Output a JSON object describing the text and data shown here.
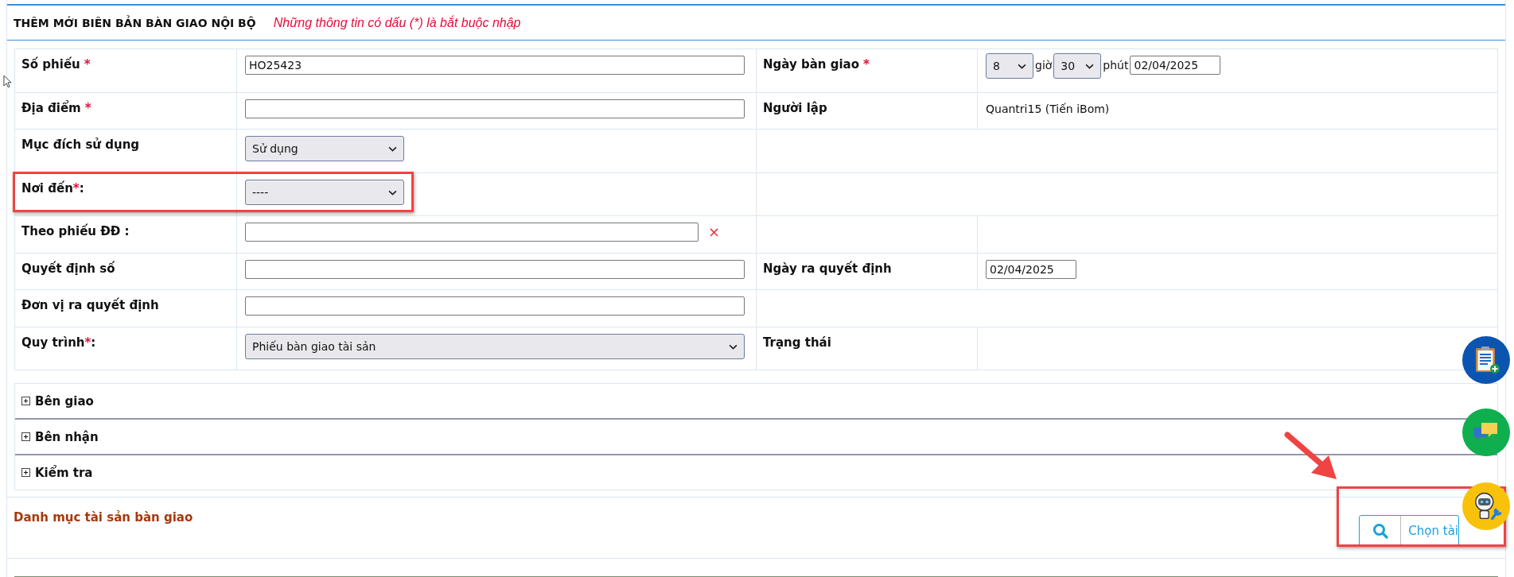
{
  "header": {
    "title": "THÊM MỚI BIÊN BẢN BÀN GIAO NỘI BỘ",
    "note": "Những thông tin có dấu (*) là bắt buộc nhập"
  },
  "rows": [
    {
      "left": {
        "label": "Số phiếu",
        "mark": "*",
        "mark_gap": true,
        "field": {
          "kind": "text",
          "value": "HO25423"
        }
      },
      "right": {
        "kind": "field",
        "label": "Ngày bàn giao",
        "mark": "*",
        "mark_gap": true,
        "field": {
          "kind": "datetime",
          "hour": "8",
          "hour_unit": "giờ",
          "minute": "30",
          "minute_unit": "phút",
          "date": "02/04/2025"
        }
      }
    },
    {
      "left": {
        "label": "Địa điểm",
        "mark": "*",
        "mark_gap": true,
        "field": {
          "kind": "text"
        }
      },
      "right": {
        "kind": "field",
        "label": "Người lập",
        "field": {
          "kind": "static",
          "value": "Quantri15 (Tiến iBom)"
        }
      }
    },
    {
      "left": {
        "label": "Mục đích sử dụng",
        "field": {
          "kind": "select",
          "value": "Sử dụng",
          "wide": false
        }
      },
      "right": {
        "kind": "blank"
      }
    },
    {
      "left": {
        "label": "Nơi đến",
        "mark": "*",
        "mark_gap": false,
        "suffix": ":",
        "field": {
          "kind": "select",
          "value": "----",
          "wide": false
        }
      },
      "right": {
        "kind": "blank"
      }
    },
    {
      "left": {
        "label": "Theo phiếu ĐĐ :",
        "field": {
          "kind": "clearable",
          "clear": "×"
        }
      },
      "right": {
        "kind": "split"
      }
    },
    {
      "left": {
        "label": "Quyết định số",
        "field": {
          "kind": "text"
        }
      },
      "right": {
        "kind": "field",
        "label": "Ngày ra quyết định",
        "field": {
          "kind": "date",
          "value": "02/04/2025"
        }
      }
    },
    {
      "left": {
        "label": "Đơn vị ra quyết định",
        "field": {
          "kind": "text"
        }
      },
      "right": {
        "kind": "blank"
      }
    },
    {
      "left": {
        "label": "Quy trình",
        "mark": "*",
        "mark_gap": false,
        "suffix": ":",
        "field": {
          "kind": "select",
          "value": "Phiếu bàn giao tài sản",
          "wide": true
        }
      },
      "right": {
        "kind": "field",
        "label": "Trạng thái"
      }
    }
  ],
  "sections": [
    {
      "label": "Bên giao",
      "expanded": false
    },
    {
      "label": "Bên nhận",
      "expanded": false
    },
    {
      "label": "Kiểm tra",
      "expanded": false
    }
  ],
  "assets": {
    "title": "Danh mục tài sản bàn giao",
    "button": "Chọn tài"
  }
}
